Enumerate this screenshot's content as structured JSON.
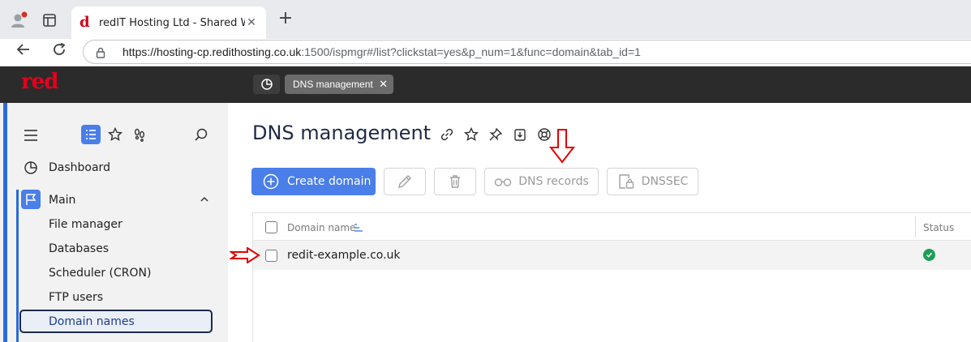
{
  "browser": {
    "tab_title": "redIT Hosting Ltd - Shared Web H",
    "url_host": "https://hosting-cp.redithosting.co.uk",
    "url_rest": ":1500/ispmgr#/list?clickstat=yes&p_num=1&func=domain&tab_id=1"
  },
  "app": {
    "logo": "red",
    "open_tab_label": "DNS management"
  },
  "sidebar": {
    "dashboard_label": "Dashboard",
    "main_label": "Main",
    "items": [
      {
        "label": "File manager"
      },
      {
        "label": "Databases"
      },
      {
        "label": "Scheduler (CRON)"
      },
      {
        "label": "FTP users"
      },
      {
        "label": "Domain names"
      }
    ]
  },
  "main": {
    "title": "DNS management",
    "toolbar": {
      "create_label": "Create domain",
      "dns_records_label": "DNS records",
      "dnssec_label": "DNSSEC"
    },
    "table": {
      "columns": [
        "Domain name",
        "Status"
      ],
      "rows": [
        {
          "domain": "redit-example.co.uk",
          "status": "ok"
        }
      ]
    }
  },
  "colors": {
    "accent": "#4a7ee8",
    "header_bg": "#2b2b2b",
    "brand_red": "#e4001b",
    "status_ok": "#1e9e5a"
  }
}
